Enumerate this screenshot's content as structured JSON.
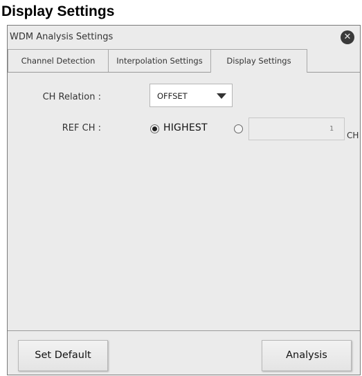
{
  "page": {
    "heading": "Display Settings"
  },
  "dialog": {
    "title": "WDM Analysis Settings",
    "close_symbol": "✕",
    "close_icon": "close-icon",
    "tabs": [
      {
        "label": "Channel Detection",
        "active": false
      },
      {
        "label": "Interpolation Settings",
        "active": false
      },
      {
        "label": "Display Settings",
        "active": true
      }
    ]
  },
  "display_settings": {
    "ch_relation": {
      "label": "CH Relation :",
      "selected": "OFFSET",
      "arrow_icon": "dropdown-arrow-icon"
    },
    "ref_ch": {
      "label": "REF CH :",
      "options": [
        {
          "label": "HIGHEST",
          "checked": true
        },
        {
          "label": "",
          "checked": false
        }
      ],
      "channel_value": "1",
      "unit": "CH"
    }
  },
  "footer": {
    "set_default_label": "Set Default",
    "analysis_label": "Analysis"
  }
}
